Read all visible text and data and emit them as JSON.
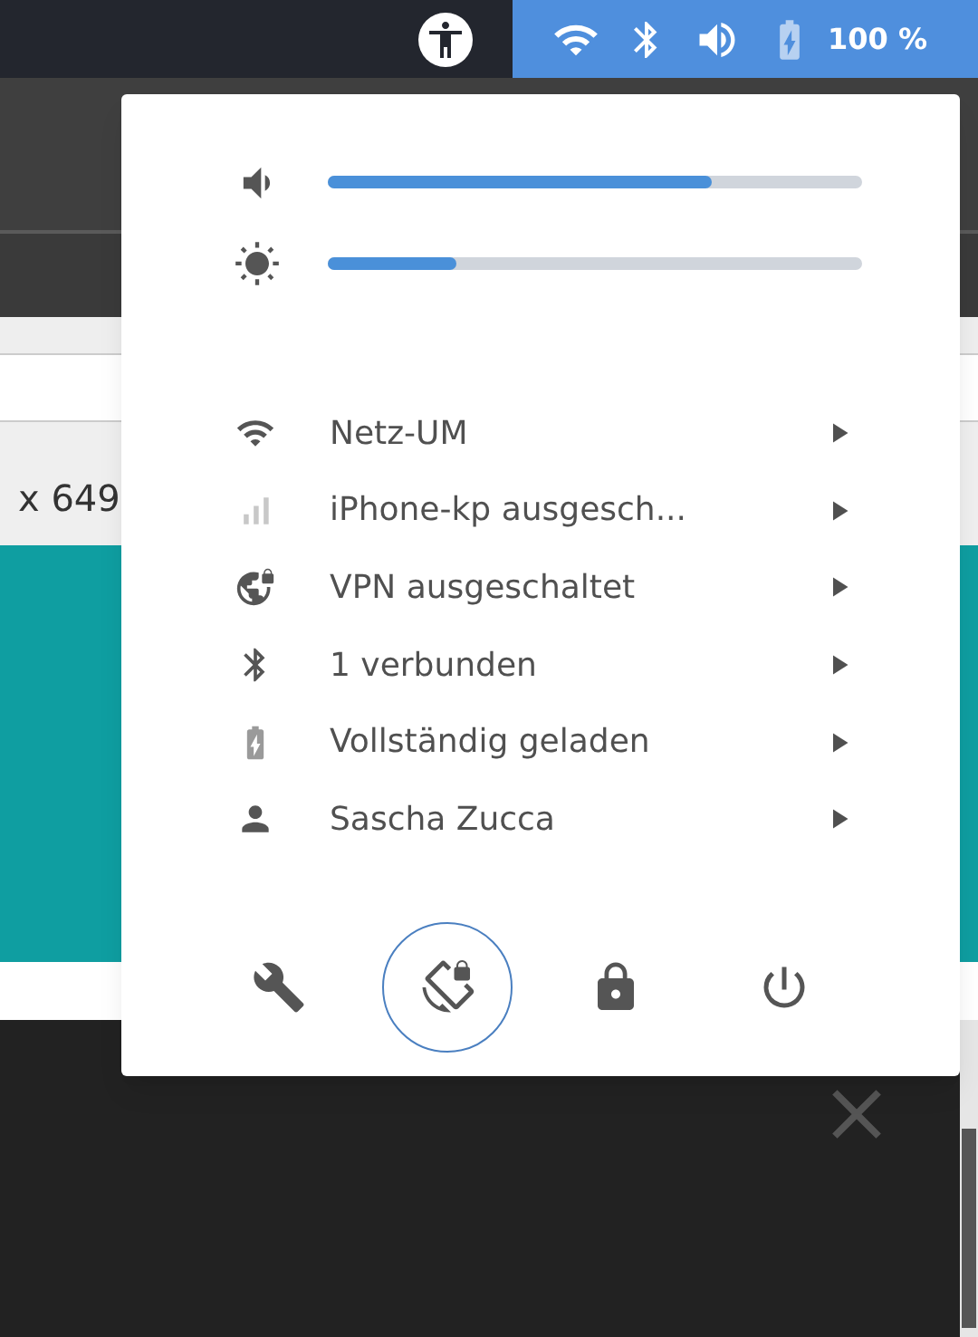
{
  "top_bar": {
    "battery_text": "100 %"
  },
  "background": {
    "row_text": "x 649"
  },
  "sliders": [
    {
      "kind": "volume",
      "level": 0.72
    },
    {
      "kind": "brightness",
      "level": 0.24
    }
  ],
  "menu_items": [
    {
      "kind": "wifi",
      "label": "Netz-UM"
    },
    {
      "kind": "cellular",
      "label": "iPhone-kp ausgesch..."
    },
    {
      "kind": "vpn",
      "label": "VPN ausgeschaltet"
    },
    {
      "kind": "bluetooth",
      "label": "1 verbunden"
    },
    {
      "kind": "battery",
      "label": "Vollständig geladen"
    },
    {
      "kind": "user",
      "label": "Sascha Zucca"
    }
  ],
  "actions": [
    {
      "kind": "settings",
      "focused": false
    },
    {
      "kind": "rotation-lock",
      "focused": true
    },
    {
      "kind": "lock",
      "focused": false
    },
    {
      "kind": "power",
      "focused": false
    }
  ]
}
